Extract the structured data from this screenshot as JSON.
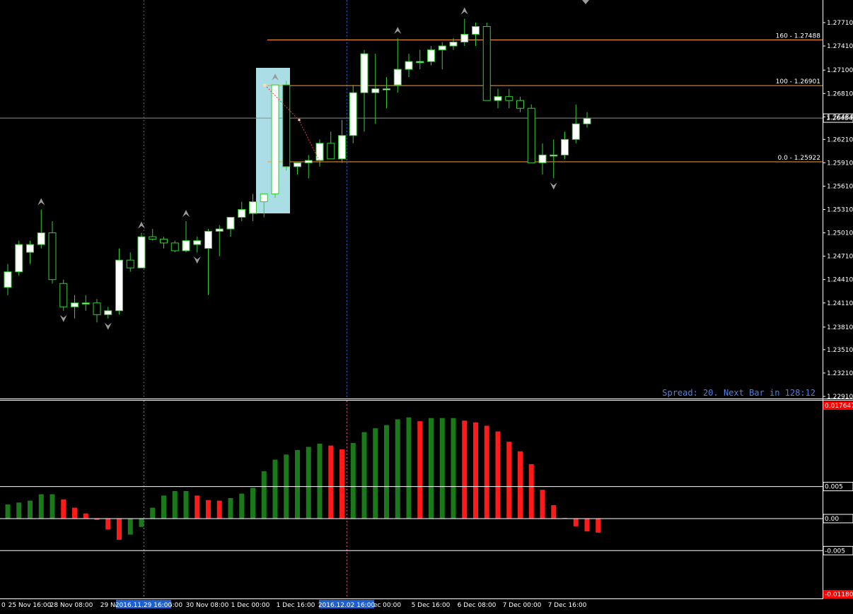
{
  "spread_text": "Spread: 20. Next Bar in 128:12",
  "colors": {
    "background": "#000000",
    "candle_outline": "#33cc33",
    "bull_body": "#ffffff",
    "bear_body": "#000000",
    "fib_line": "#ff9933",
    "grid": "#ffffff",
    "histogram_up": "#1a7a1a",
    "histogram_down": "#ff1a1a",
    "highlight_box": "#aadde6",
    "spread_text": "#4f7fe6",
    "crosshair_date_bg": "#1e5fd0",
    "osc_min_label_bg": "#ff0000"
  },
  "time_labels": [
    "0",
    "25 Nov 16:00",
    "28 Nov 08:00",
    "29 No",
    "6:00",
    "30 Nov 08:00",
    "1 Dec 00:00",
    "1 Dec 16:00",
    "Dec 00:00",
    "5 Dec 16:00",
    "6 Dec 08:00",
    "7 Dec 00:00",
    "7 Dec 16:00"
  ],
  "crosshair_dates": [
    "2016.11.29 16:00",
    "2016.12.02 16:00"
  ],
  "price_current_label": "1.26484",
  "osc_labels": {
    "max": "0.017647",
    "upper": "0.005",
    "zero": "0.00",
    "lower": "-0.005",
    "min": "-0.011806"
  },
  "chart_data": [
    {
      "type": "candlestick",
      "y_ticks": [
        1.2771,
        1.2741,
        1.271,
        1.268,
        1.265,
        1.2621,
        1.2591,
        1.2561,
        1.2531,
        1.2501,
        1.2471,
        1.2441,
        1.2411,
        1.238,
        1.2351,
        1.2321,
        1.2291
      ],
      "y_tick_labels": [
        "1.27710",
        "1.27410",
        "1.27100",
        "1.26810",
        "1.26484",
        "1.26210",
        "1.25910",
        "1.25610",
        "1.25310",
        "1.25010",
        "1.24710",
        "1.24410",
        "1.24110",
        "1.23810",
        "1.23510",
        "1.23210",
        "1.22910"
      ],
      "ylim": [
        1.2291,
        1.2786
      ],
      "current_price": 1.26484,
      "fibonacci": [
        {
          "label": "160  -  1.27488",
          "value": 1.27488
        },
        {
          "label": "100  -  1.26901",
          "value": 1.26901
        },
        {
          "label": "0.0  -  1.25922",
          "value": 1.25922
        }
      ],
      "candles": [
        [
          1.2431,
          1.2461,
          1.2421,
          1.2451
        ],
        [
          1.2451,
          1.2491,
          1.2446,
          1.2486
        ],
        [
          1.2476,
          1.2491,
          1.2461,
          1.2486
        ],
        [
          1.2486,
          1.2531,
          1.2481,
          1.2501
        ],
        [
          1.2501,
          1.2516,
          1.2436,
          1.2441
        ],
        [
          1.2436,
          1.2441,
          1.2401,
          1.2406
        ],
        [
          1.2406,
          1.2421,
          1.2391,
          1.2411
        ],
        [
          1.2411,
          1.2421,
          1.2401,
          1.2411
        ],
        [
          1.2411,
          1.2416,
          1.2386,
          1.2396
        ],
        [
          1.2396,
          1.2406,
          1.2391,
          1.2401
        ],
        [
          1.2401,
          1.2481,
          1.2396,
          1.2466
        ],
        [
          1.2466,
          1.2476,
          1.2451,
          1.2456
        ],
        [
          1.2456,
          1.2501,
          1.2456,
          1.2496
        ],
        [
          1.2496,
          1.2506,
          1.2491,
          1.2493
        ],
        [
          1.2493,
          1.2496,
          1.2481,
          1.2488
        ],
        [
          1.2488,
          1.2491,
          1.2476,
          1.2478
        ],
        [
          1.2478,
          1.2516,
          1.2476,
          1.2491
        ],
        [
          1.2486,
          1.2496,
          1.2476,
          1.2491
        ],
        [
          1.2481,
          1.2506,
          1.2421,
          1.2503
        ],
        [
          1.2503,
          1.2511,
          1.2471,
          1.2506
        ],
        [
          1.2506,
          1.2521,
          1.2496,
          1.2521
        ],
        [
          1.2521,
          1.2541,
          1.2516,
          1.2531
        ],
        [
          1.2526,
          1.2551,
          1.2516,
          1.2541
        ],
        [
          1.2541,
          1.2551,
          1.2521,
          1.2551
        ],
        [
          1.2551,
          1.2691,
          1.2546,
          1.2691
        ],
        [
          1.2691,
          1.2696,
          1.2581,
          1.2586
        ],
        [
          1.2586,
          1.2591,
          1.2576,
          1.2591
        ],
        [
          1.2591,
          1.2601,
          1.2571,
          1.2594
        ],
        [
          1.2594,
          1.2621,
          1.2586,
          1.2616
        ],
        [
          1.2616,
          1.2631,
          1.2596,
          1.2596
        ],
        [
          1.2596,
          1.2646,
          1.2591,
          1.2626
        ],
        [
          1.2626,
          1.2691,
          1.2616,
          1.2681
        ],
        [
          1.2681,
          1.2736,
          1.2631,
          1.2731
        ],
        [
          1.2681,
          1.2731,
          1.2641,
          1.2686
        ],
        [
          1.2686,
          1.2701,
          1.2661,
          1.2686
        ],
        [
          1.2691,
          1.2751,
          1.2681,
          1.2711
        ],
        [
          1.2711,
          1.2731,
          1.2701,
          1.2721
        ],
        [
          1.2721,
          1.2736,
          1.2711,
          1.2721
        ],
        [
          1.2721,
          1.2741,
          1.2716,
          1.2736
        ],
        [
          1.2736,
          1.2746,
          1.2711,
          1.2741
        ],
        [
          1.2741,
          1.2751,
          1.2736,
          1.2746
        ],
        [
          1.2746,
          1.2776,
          1.2741,
          1.2756
        ],
        [
          1.2756,
          1.2771,
          1.2741,
          1.2766
        ],
        [
          1.2766,
          1.2771,
          1.2671,
          1.2671
        ],
        [
          1.2671,
          1.2686,
          1.2661,
          1.2676
        ],
        [
          1.2676,
          1.2686,
          1.2661,
          1.2671
        ],
        [
          1.2671,
          1.2676,
          1.2656,
          1.2661
        ],
        [
          1.2661,
          1.2666,
          1.2591,
          1.2591
        ],
        [
          1.2591,
          1.2616,
          1.2576,
          1.2601
        ],
        [
          1.2601,
          1.2621,
          1.2571,
          1.2601
        ],
        [
          1.2601,
          1.2631,
          1.2596,
          1.2621
        ],
        [
          1.2621,
          1.2666,
          1.2616,
          1.2641
        ],
        [
          1.2641,
          1.2656,
          1.2636,
          1.2648
        ]
      ]
    },
    {
      "type": "bar",
      "ylim": [
        -0.011806,
        0.017647
      ],
      "reference_lines": [
        0.005,
        0.0,
        -0.005
      ],
      "values": [
        0.0022,
        0.0025,
        0.0028,
        0.0038,
        0.0038,
        0.003,
        0.0017,
        0.0008,
        -0.0002,
        -0.0017,
        -0.0033,
        -0.0025,
        -0.0013,
        0.0017,
        0.0036,
        0.0043,
        0.0043,
        0.0036,
        0.0029,
        0.0028,
        0.0032,
        0.0039,
        0.0048,
        0.0074,
        0.0092,
        0.01,
        0.0107,
        0.0112,
        0.0117,
        0.0114,
        0.0108,
        0.0118,
        0.0135,
        0.0141,
        0.0146,
        0.0155,
        0.0158,
        0.0152,
        0.0157,
        0.0157,
        0.0157,
        0.0153,
        0.015,
        0.0145,
        0.0136,
        0.012,
        0.0105,
        0.0085,
        0.0045,
        0.0021,
        0.0001,
        -0.0012,
        -0.002,
        -0.0022
      ]
    }
  ]
}
